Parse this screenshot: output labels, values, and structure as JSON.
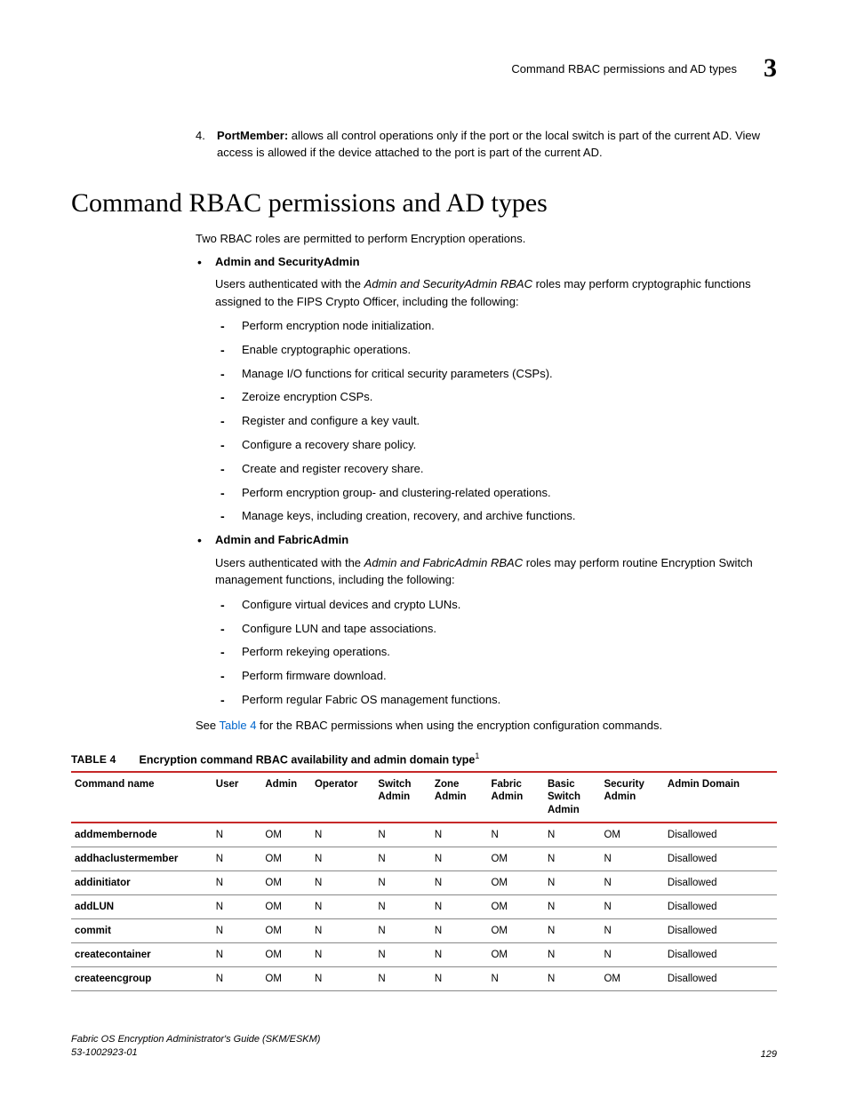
{
  "header": {
    "title": "Command RBAC permissions and AD types",
    "chapter_number": "3"
  },
  "numbered_item": {
    "number": "4.",
    "label": "PortMember:",
    "text": " allows all control operations only if the port or the local switch is part of the current AD. View access is allowed if the device attached to the port is part of the current AD."
  },
  "section_heading": "Command RBAC permissions and AD types",
  "intro_text": "Two RBAC roles are permitted to perform Encryption operations.",
  "roles": [
    {
      "title": "Admin and SecurityAdmin",
      "para_prefix": "Users authenticated with the ",
      "para_italic": "Admin and SecurityAdmin RBAC",
      "para_suffix": " roles may perform cryptographic functions assigned to the FIPS Crypto Officer, including the following:",
      "items": [
        "Perform encryption node initialization.",
        "Enable cryptographic operations.",
        "Manage I/O functions for critical security parameters (CSPs).",
        "Zeroize encryption CSPs.",
        "Register and configure a key vault.",
        "Configure a recovery share policy.",
        "Create and register recovery share.",
        "Perform encryption group- and clustering-related operations.",
        "Manage keys, including creation, recovery, and archive functions."
      ]
    },
    {
      "title": "Admin and FabricAdmin",
      "para_prefix": "Users authenticated with the ",
      "para_italic": "Admin and FabricAdmin RBAC",
      "para_suffix": " roles may perform routine Encryption Switch management functions, including the following:",
      "items": [
        "Configure virtual devices and crypto LUNs.",
        "Configure LUN and tape associations.",
        "Perform rekeying operations.",
        "Perform firmware download.",
        "Perform regular Fabric OS management functions."
      ]
    }
  ],
  "see_line": {
    "prefix": "See ",
    "link": "Table 4",
    "suffix": " for the RBAC permissions when using the encryption configuration commands."
  },
  "table": {
    "label": "TABLE 4",
    "caption": "Encryption command RBAC availability and admin domain type",
    "caption_sup": "1",
    "columns": [
      "Command name",
      "User",
      "Admin",
      "Operator",
      "Switch Admin",
      "Zone Admin",
      "Fabric Admin",
      "Basic Switch Admin",
      "Security Admin",
      "Admin Domain"
    ],
    "rows": [
      [
        "addmembernode",
        "N",
        "OM",
        "N",
        "N",
        "N",
        "N",
        "N",
        "OM",
        "Disallowed"
      ],
      [
        "addhaclustermember",
        "N",
        "OM",
        "N",
        "N",
        "N",
        "OM",
        "N",
        "N",
        "Disallowed"
      ],
      [
        "addinitiator",
        "N",
        "OM",
        "N",
        "N",
        "N",
        "OM",
        "N",
        "N",
        "Disallowed"
      ],
      [
        "addLUN",
        "N",
        "OM",
        "N",
        "N",
        "N",
        "OM",
        "N",
        "N",
        "Disallowed"
      ],
      [
        "commit",
        "N",
        "OM",
        "N",
        "N",
        "N",
        "OM",
        "N",
        "N",
        "Disallowed"
      ],
      [
        "createcontainer",
        "N",
        "OM",
        "N",
        "N",
        "N",
        "OM",
        "N",
        "N",
        "Disallowed"
      ],
      [
        "createencgroup",
        "N",
        "OM",
        "N",
        "N",
        "N",
        "N",
        "N",
        "OM",
        "Disallowed"
      ]
    ]
  },
  "footer": {
    "line1": "Fabric OS Encryption Administrator's Guide (SKM/ESKM)",
    "line2": "53-1002923-01",
    "page": "129"
  }
}
